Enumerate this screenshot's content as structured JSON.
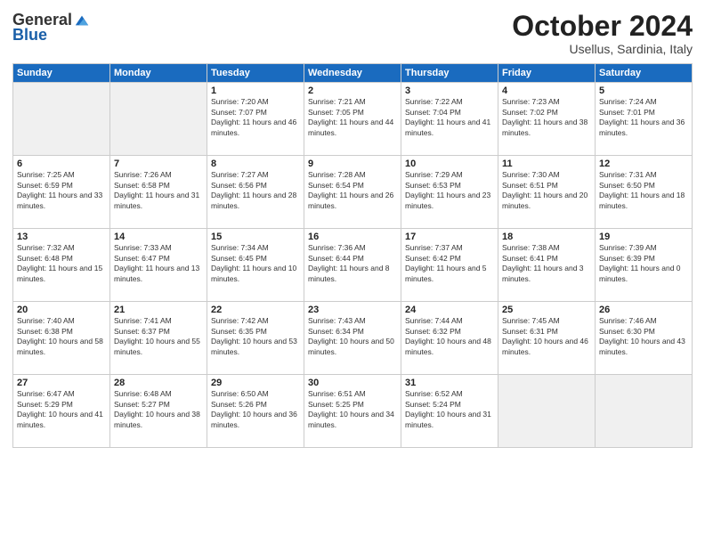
{
  "header": {
    "logo_general": "General",
    "logo_blue": "Blue",
    "title": "October 2024",
    "subtitle": "Usellus, Sardinia, Italy"
  },
  "weekdays": [
    "Sunday",
    "Monday",
    "Tuesday",
    "Wednesday",
    "Thursday",
    "Friday",
    "Saturday"
  ],
  "weeks": [
    [
      {
        "day": "",
        "info": ""
      },
      {
        "day": "",
        "info": ""
      },
      {
        "day": "1",
        "info": "Sunrise: 7:20 AM\nSunset: 7:07 PM\nDaylight: 11 hours and 46 minutes."
      },
      {
        "day": "2",
        "info": "Sunrise: 7:21 AM\nSunset: 7:05 PM\nDaylight: 11 hours and 44 minutes."
      },
      {
        "day": "3",
        "info": "Sunrise: 7:22 AM\nSunset: 7:04 PM\nDaylight: 11 hours and 41 minutes."
      },
      {
        "day": "4",
        "info": "Sunrise: 7:23 AM\nSunset: 7:02 PM\nDaylight: 11 hours and 38 minutes."
      },
      {
        "day": "5",
        "info": "Sunrise: 7:24 AM\nSunset: 7:01 PM\nDaylight: 11 hours and 36 minutes."
      }
    ],
    [
      {
        "day": "6",
        "info": "Sunrise: 7:25 AM\nSunset: 6:59 PM\nDaylight: 11 hours and 33 minutes."
      },
      {
        "day": "7",
        "info": "Sunrise: 7:26 AM\nSunset: 6:58 PM\nDaylight: 11 hours and 31 minutes."
      },
      {
        "day": "8",
        "info": "Sunrise: 7:27 AM\nSunset: 6:56 PM\nDaylight: 11 hours and 28 minutes."
      },
      {
        "day": "9",
        "info": "Sunrise: 7:28 AM\nSunset: 6:54 PM\nDaylight: 11 hours and 26 minutes."
      },
      {
        "day": "10",
        "info": "Sunrise: 7:29 AM\nSunset: 6:53 PM\nDaylight: 11 hours and 23 minutes."
      },
      {
        "day": "11",
        "info": "Sunrise: 7:30 AM\nSunset: 6:51 PM\nDaylight: 11 hours and 20 minutes."
      },
      {
        "day": "12",
        "info": "Sunrise: 7:31 AM\nSunset: 6:50 PM\nDaylight: 11 hours and 18 minutes."
      }
    ],
    [
      {
        "day": "13",
        "info": "Sunrise: 7:32 AM\nSunset: 6:48 PM\nDaylight: 11 hours and 15 minutes."
      },
      {
        "day": "14",
        "info": "Sunrise: 7:33 AM\nSunset: 6:47 PM\nDaylight: 11 hours and 13 minutes."
      },
      {
        "day": "15",
        "info": "Sunrise: 7:34 AM\nSunset: 6:45 PM\nDaylight: 11 hours and 10 minutes."
      },
      {
        "day": "16",
        "info": "Sunrise: 7:36 AM\nSunset: 6:44 PM\nDaylight: 11 hours and 8 minutes."
      },
      {
        "day": "17",
        "info": "Sunrise: 7:37 AM\nSunset: 6:42 PM\nDaylight: 11 hours and 5 minutes."
      },
      {
        "day": "18",
        "info": "Sunrise: 7:38 AM\nSunset: 6:41 PM\nDaylight: 11 hours and 3 minutes."
      },
      {
        "day": "19",
        "info": "Sunrise: 7:39 AM\nSunset: 6:39 PM\nDaylight: 11 hours and 0 minutes."
      }
    ],
    [
      {
        "day": "20",
        "info": "Sunrise: 7:40 AM\nSunset: 6:38 PM\nDaylight: 10 hours and 58 minutes."
      },
      {
        "day": "21",
        "info": "Sunrise: 7:41 AM\nSunset: 6:37 PM\nDaylight: 10 hours and 55 minutes."
      },
      {
        "day": "22",
        "info": "Sunrise: 7:42 AM\nSunset: 6:35 PM\nDaylight: 10 hours and 53 minutes."
      },
      {
        "day": "23",
        "info": "Sunrise: 7:43 AM\nSunset: 6:34 PM\nDaylight: 10 hours and 50 minutes."
      },
      {
        "day": "24",
        "info": "Sunrise: 7:44 AM\nSunset: 6:32 PM\nDaylight: 10 hours and 48 minutes."
      },
      {
        "day": "25",
        "info": "Sunrise: 7:45 AM\nSunset: 6:31 PM\nDaylight: 10 hours and 46 minutes."
      },
      {
        "day": "26",
        "info": "Sunrise: 7:46 AM\nSunset: 6:30 PM\nDaylight: 10 hours and 43 minutes."
      }
    ],
    [
      {
        "day": "27",
        "info": "Sunrise: 6:47 AM\nSunset: 5:29 PM\nDaylight: 10 hours and 41 minutes."
      },
      {
        "day": "28",
        "info": "Sunrise: 6:48 AM\nSunset: 5:27 PM\nDaylight: 10 hours and 38 minutes."
      },
      {
        "day": "29",
        "info": "Sunrise: 6:50 AM\nSunset: 5:26 PM\nDaylight: 10 hours and 36 minutes."
      },
      {
        "day": "30",
        "info": "Sunrise: 6:51 AM\nSunset: 5:25 PM\nDaylight: 10 hours and 34 minutes."
      },
      {
        "day": "31",
        "info": "Sunrise: 6:52 AM\nSunset: 5:24 PM\nDaylight: 10 hours and 31 minutes."
      },
      {
        "day": "",
        "info": ""
      },
      {
        "day": "",
        "info": ""
      }
    ]
  ]
}
